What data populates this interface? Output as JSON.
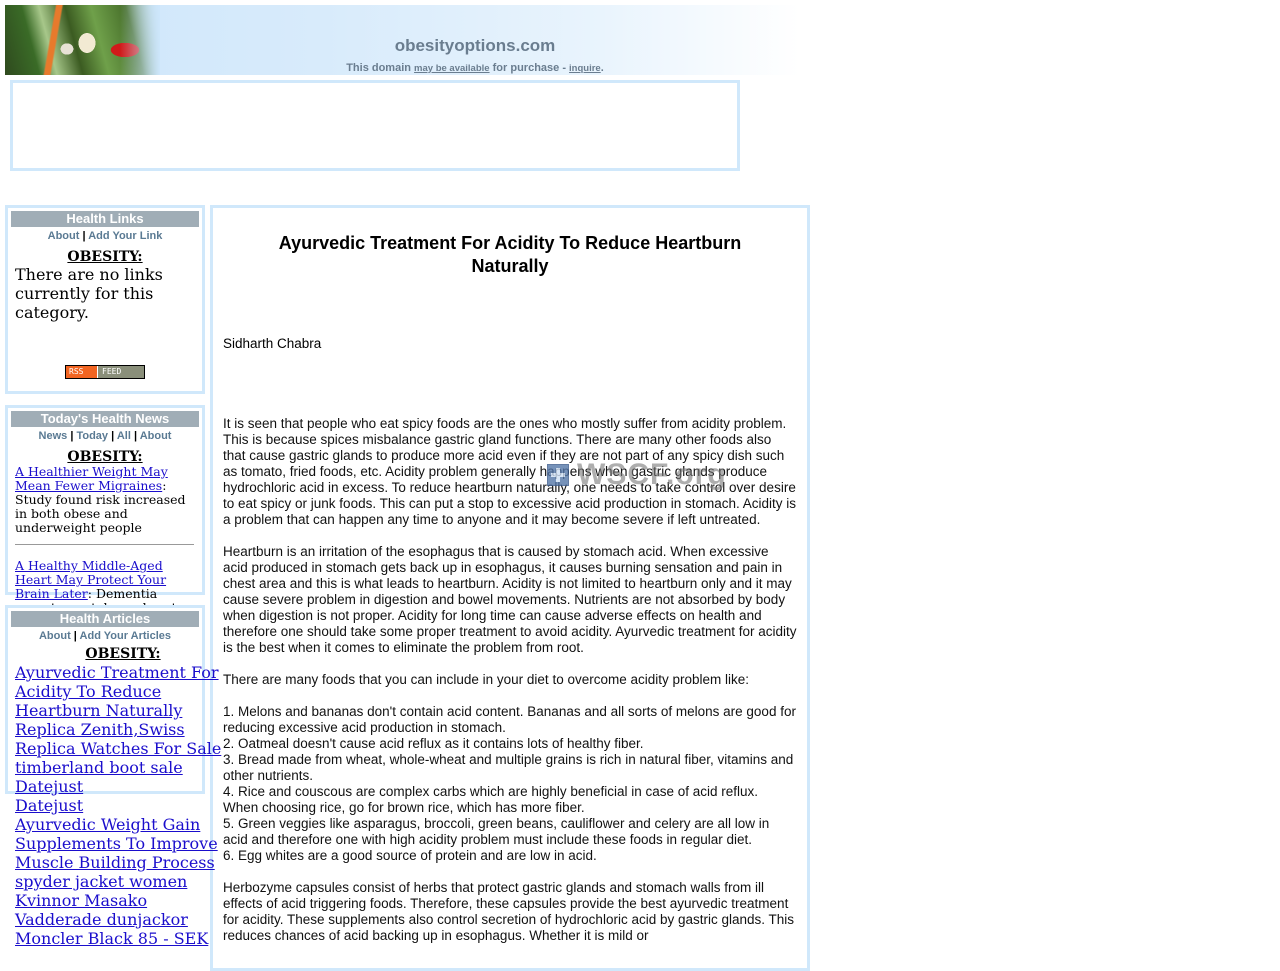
{
  "banner": {
    "domain": "obesityoptions.com",
    "sub_prefix": "This domain ",
    "sub_link1": "may be available",
    "sub_middle": " for purchase - ",
    "sub_link2": "inquire",
    "sub_suffix": "."
  },
  "health_links": {
    "title": "Health Links",
    "nav": [
      "About",
      "Add Your Link"
    ],
    "category": "OBESITY:",
    "empty_text": "There are no links currently for this category.",
    "rss": {
      "left": "RSS",
      "right": "FEED"
    }
  },
  "health_news": {
    "title": "Today's Health News",
    "nav": [
      "News",
      "Today",
      "All",
      "About"
    ],
    "category": "OBESITY:",
    "items": [
      {
        "link": "A Healthier Weight May Mean Fewer Migraines",
        "desc": ": Study found risk increased in both obese and underweight people"
      },
      {
        "link": "A Healthy Middle-Aged Heart May Protect Your Brain Later",
        "desc": ": Dementia expert says take up heart-healthy habits as early as mid-life or earlier"
      }
    ]
  },
  "health_articles": {
    "title": "Health Articles",
    "nav": [
      "About",
      "Add Your Articles"
    ],
    "category": "OBESITY:",
    "items": [
      "Ayurvedic Treatment For",
      "Acidity To Reduce",
      "Heartburn Naturally",
      "Replica Zenith,Swiss",
      "Replica Watches For Sale",
      "timberland boot sale",
      "Datejust",
      "Datejust",
      "Ayurvedic Weight Gain",
      "Supplements To Improve",
      "Muscle Building Process",
      "spyder jacket women",
      "Kvinnor Masako",
      "Vadderade dunjackor",
      "Moncler Black 85 - SEK"
    ]
  },
  "article": {
    "title": "Ayurvedic Treatment For Acidity To Reduce Heartburn Naturally",
    "author": "Sidharth Chabra",
    "paragraphs": [
      "It is seen that people who eat spicy foods are the ones who mostly suffer from acidity problem. This is because spices misbalance gastric gland functions. There are many other foods also that cause gastric glands to produce more acid even if they are not part of any spicy dish such as tomato, fried foods, etc. Acidity problem generally happens when gastric glands produce hydrochloric acid in excess. To reduce heartburn naturally, one needs to take control over desire to eat spicy or junk foods. This can put a stop to excessive acid production in stomach. Acidity is a problem that can happen any time to anyone and it may become severe if left untreated.",
      "Heartburn is an irritation of the esophagus that is caused by stomach acid. When excessive acid produced in stomach gets back up in esophagus, it causes burning sensation and pain in chest area and this is what leads to heartburn. Acidity is not limited to heartburn only and it may cause severe problem in digestion and bowel movements. Nutrients are not absorbed by body when digestion is not proper. Acidity for long time can cause adverse effects on health and therefore one should take some proper treatment to avoid acidity. Ayurvedic treatment for acidity is the best when it comes to eliminate the problem from root.",
      "There are many foods that you can include in your diet to overcome acidity problem like:"
    ],
    "list": [
      "1. Melons and bananas don't contain acid content. Bananas and all sorts of melons are good for reducing excessive acid production in stomach.",
      "2. Oatmeal doesn't cause acid reflux as it contains lots of healthy fiber.",
      "3. Bread made from wheat, whole-wheat and multiple grains is rich in natural fiber, vitamins and other nutrients.",
      "4. Rice and couscous are complex carbs which are highly beneficial in case of acid reflux. When choosing rice, go for brown rice, which has more fiber.",
      "5. Green veggies like asparagus, broccoli, green beans, cauliflower and celery are all low in acid and therefore one with high acidity problem must include these foods in regular diet.",
      "6. Egg whites are a good source of protein and are low in acid."
    ],
    "closing": "Herbozyme capsules consist of herbs that protect gastric glands and stomach walls from ill effects of acid triggering foods. Therefore, these capsules provide the best ayurvedic treatment for acidity. These supplements also control secretion of hydrochloric acid by gastric glands. This reduces chances of acid backing up in esophagus. Whether it is mild or"
  },
  "watermark": {
    "text": "WSCF.org"
  }
}
